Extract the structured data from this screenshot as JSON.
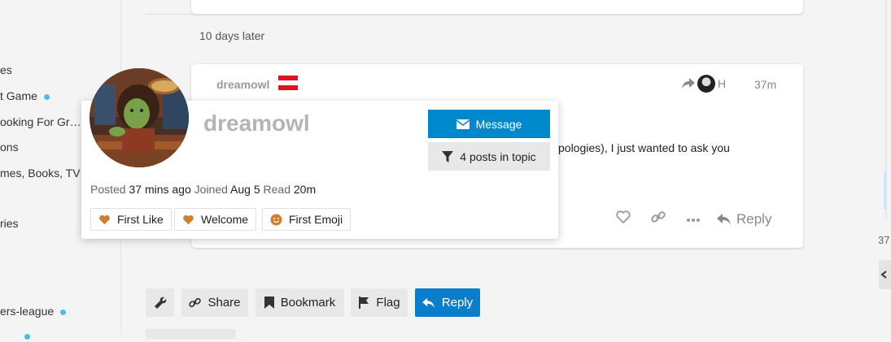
{
  "sidebar": {
    "items": [
      {
        "label": "es",
        "dot": false
      },
      {
        "label": "t Game",
        "dot": true
      },
      {
        "label": "ooking For Gr…",
        "dot": false
      },
      {
        "label": "ons",
        "dot": false
      },
      {
        "label": "mes, Books, TV",
        "dot": false
      },
      {
        "label": "ries",
        "dot": false
      },
      {
        "label": "ers-league",
        "dot": true
      }
    ]
  },
  "timeline": {
    "label": "37"
  },
  "gap_text": "10 days later",
  "post": {
    "username": "dreamowl",
    "reply_to_initial": "H",
    "time": "37m",
    "body_visible": "pologies), I just wanted to ask you",
    "reply_label": "Reply",
    "flag_colors": [
      "#e1121f",
      "#ffffff",
      "#e1121f"
    ]
  },
  "user_card": {
    "name": "dreamowl",
    "message_label": "Message",
    "posts_in_topic_label": "4 posts in topic",
    "meta": {
      "posted_label": "Posted",
      "posted_value": "37 mins ago",
      "joined_label": "Joined",
      "joined_value": "Aug 5",
      "read_label": "Read",
      "read_value": "20m"
    },
    "badges": [
      "First Like",
      "Welcome",
      "First Emoji"
    ]
  },
  "footer_buttons": {
    "share": "Share",
    "bookmark": "Bookmark",
    "flag": "Flag",
    "reply": "Reply"
  },
  "colors": {
    "accent": "#0a7ecb",
    "card_button": "#0088cc",
    "badge_bronze": "#cd7f32",
    "dot": "#51b8ea"
  }
}
